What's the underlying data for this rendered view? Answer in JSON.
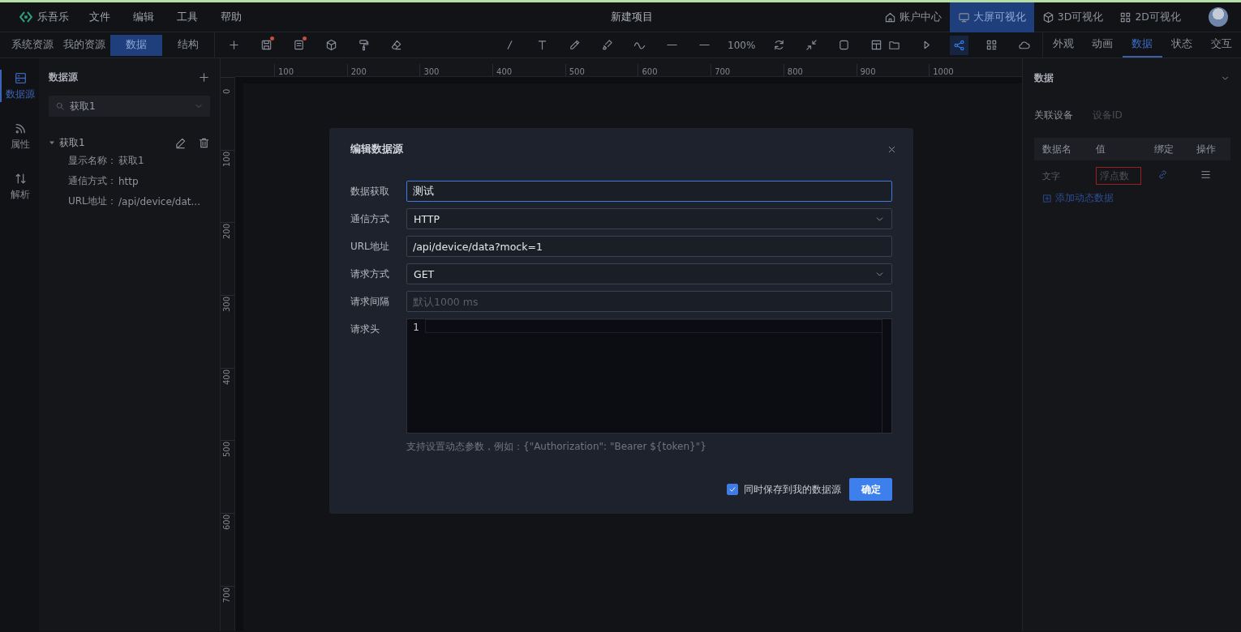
{
  "app": {
    "brand": "乐吾乐",
    "menu": [
      "文件",
      "编辑",
      "工具",
      "帮助"
    ],
    "title": "新建项目",
    "nav": [
      {
        "label": "账户中心",
        "selected": false
      },
      {
        "label": "大屏可视化",
        "selected": true
      },
      {
        "label": "3D可视化",
        "selected": false
      },
      {
        "label": "2D可视化",
        "selected": false
      }
    ]
  },
  "left_tabs": [
    {
      "label": "系统资源",
      "selected": false
    },
    {
      "label": "我的资源",
      "selected": false
    },
    {
      "label": "数据",
      "selected": true
    },
    {
      "label": "结构",
      "selected": false
    }
  ],
  "toolbar": {
    "left_tools": [
      {
        "badge": false
      },
      {
        "badge": true
      },
      {
        "badge": true
      },
      {
        "badge": false
      },
      {
        "badge": false
      },
      {
        "badge": false
      }
    ],
    "zoom": "100%",
    "right_tools": [
      {
        "selected": false
      },
      {
        "selected": false
      },
      {
        "selected": true
      },
      {
        "selected": false
      },
      {
        "selected": false
      }
    ]
  },
  "right_tabs": [
    {
      "label": "外观",
      "selected": false
    },
    {
      "label": "动画",
      "selected": false
    },
    {
      "label": "数据",
      "selected": true
    },
    {
      "label": "状态",
      "selected": false
    },
    {
      "label": "交互",
      "selected": false
    }
  ],
  "rail": [
    {
      "label": "数据源",
      "selected": true
    },
    {
      "label": "属性",
      "selected": false
    },
    {
      "label": "解析",
      "selected": false
    }
  ],
  "datasource_panel": {
    "title": "数据源",
    "search": {
      "value": "获取1"
    },
    "tree": [
      {
        "label": "获取1",
        "expanded": true,
        "details": [
          {
            "label": "显示名称：",
            "value": "获取1"
          },
          {
            "label": "通信方式：",
            "value": "http"
          },
          {
            "label": "URL地址：",
            "value": "/api/device/dat..."
          }
        ]
      }
    ]
  },
  "rulers": {
    "horizontal": [
      "100",
      "200",
      "300",
      "400",
      "500",
      "600",
      "700",
      "800",
      "900",
      "1000"
    ],
    "vertical": [
      "0",
      "100",
      "200",
      "300",
      "400",
      "500",
      "600",
      "700"
    ]
  },
  "dialog": {
    "title": "编辑数据源",
    "fields": [
      {
        "kind": "input",
        "label": "数据获取",
        "value": "测试",
        "focused": true
      },
      {
        "kind": "select",
        "label": "通信方式",
        "value": "HTTP",
        "focused": false
      },
      {
        "kind": "input",
        "label": "URL地址",
        "value": "/api/device/data?mock=1",
        "focused": false
      },
      {
        "kind": "select",
        "label": "请求方式",
        "value": "GET",
        "focused": false
      },
      {
        "kind": "input",
        "label": "请求间隔",
        "placeholder": "默认1000 ms",
        "focused": false
      },
      {
        "kind": "code",
        "label": "请求头",
        "line_numbers": [
          "1"
        ],
        "focused": false
      }
    ],
    "hint": "支持设置动态参数，例如：{\"Authorization\": \"Bearer ${token}\"}",
    "save_copy": {
      "label": "同时保存到我的数据源",
      "checked": true
    },
    "confirm": "确定"
  },
  "properties": {
    "section": {
      "title": "数据",
      "expanded": true
    },
    "device": {
      "label": "关联设备",
      "placeholder": "设备ID"
    },
    "columns": [
      "数据名",
      "值",
      "绑定",
      "操作"
    ],
    "rows": [
      {
        "name": "文字",
        "value_placeholder": "浮点数",
        "invalid": true
      }
    ],
    "add_link": "添加动态数据"
  }
}
